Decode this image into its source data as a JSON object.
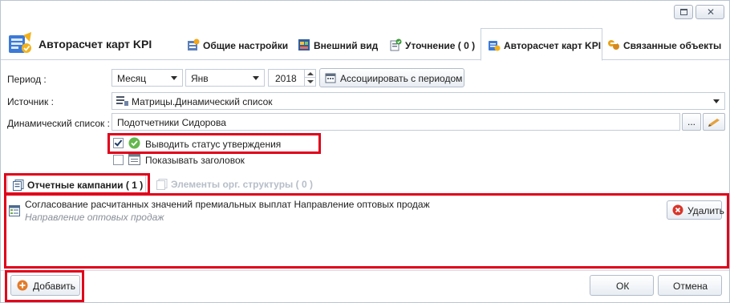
{
  "window": {
    "restore_icon": "restore-icon",
    "close_icon": "close-icon"
  },
  "header": {
    "title": "Авторасчет карт KPI",
    "tabs": [
      {
        "label": "Общие настройки",
        "icon": "settings-icon"
      },
      {
        "label": "Внешний вид",
        "icon": "appearance-icon"
      },
      {
        "label": "Уточнение ( 0 )",
        "icon": "refine-icon"
      },
      {
        "label": "Авторасчет карт KPI",
        "icon": "kpi-icon",
        "active": true
      },
      {
        "label": "Связанные объекты",
        "icon": "linked-objects-icon"
      }
    ]
  },
  "form": {
    "period_label": "Период :",
    "period_type": "Месяц",
    "period_month": "Янв",
    "period_year": "2018",
    "associate_button": "Ассоциировать с периодом",
    "source_label": "Источник :",
    "source_value": "Матрицы.Динамический список",
    "dynamic_list_label": "Динамический список :",
    "dynamic_list_value": "Подотчетники Сидорова",
    "browse_button": "...",
    "show_approval_status": {
      "label": "Выводить статус утверждения",
      "checked": true
    },
    "show_header": {
      "label": "Показывать заголовок",
      "checked": false
    }
  },
  "inner_tabs": [
    {
      "label": "Отчетные кампании ( 1 )",
      "active": true
    },
    {
      "label": "Элементы орг. структуры ( 0 )",
      "active": false,
      "disabled": true
    }
  ],
  "campaigns": [
    {
      "title": "Согласование расчитанных значений премиальных выплат Направление оптовых продаж",
      "subtitle": "Направление оптовых продаж",
      "delete_label": "Удалить"
    }
  ],
  "footer": {
    "add_button": "Добавить",
    "ok_button": "ОК",
    "cancel_button": "Отмена"
  },
  "colors": {
    "highlight": "#e0001a",
    "border": "#c7d1de"
  }
}
